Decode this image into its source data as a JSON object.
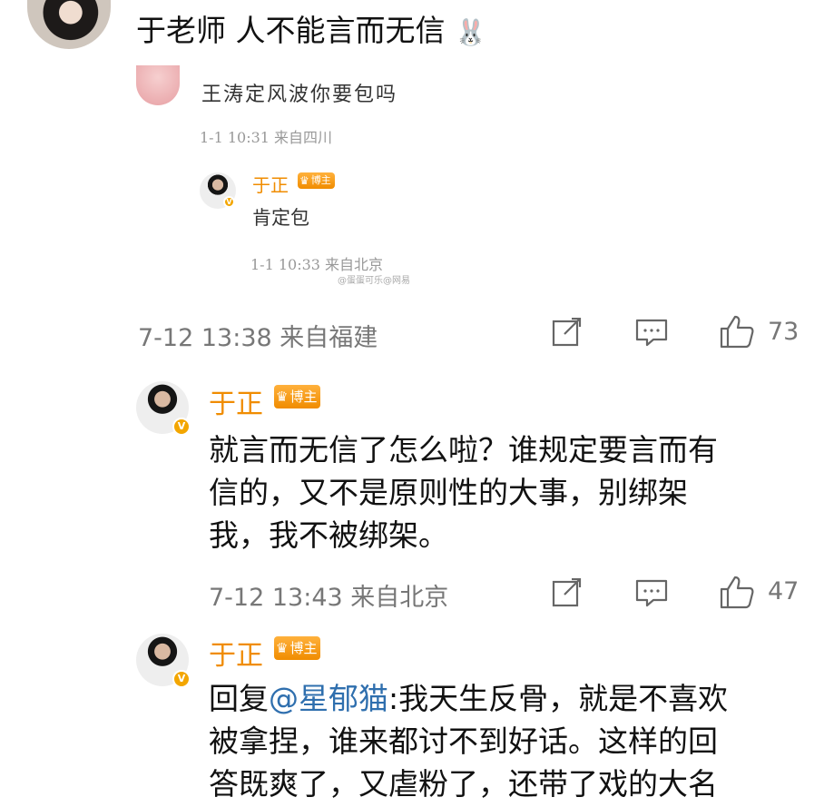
{
  "top_comment": {
    "text": "于老师 人不能言而无信",
    "emoji": "🐰"
  },
  "screenshot_quote": {
    "comment_text": "王涛定风波你要包吗",
    "comment_meta": "1-1 10:31 来自四川",
    "reply_author": "于正",
    "reply_badge": "博主",
    "reply_text": "肯定包",
    "reply_meta": "1-1 10:33 来自北京",
    "watermark": "@蛋蛋可乐@网易"
  },
  "top_comment_footer": {
    "meta": "7-12 13:38 来自福建",
    "likes": "73"
  },
  "reply1": {
    "author": "于正",
    "badge": "博主",
    "line1": "就言而无信了怎么啦？谁规定要言而有",
    "line2": "信的，又不是原则性的大事，别绑架",
    "line3": "我，我不被绑架。",
    "meta": "7-12 13:43 来自北京",
    "likes": "47"
  },
  "reply2": {
    "author": "于正",
    "badge": "博主",
    "prefix": "回复",
    "mention": "@星郁猫",
    "line1_rest": ":我天生反骨，就是不喜欢",
    "line2": "被拿捏，谁来都讨不到好话。这样的回",
    "line3": "答既爽了，又虐粉了，还带了戏的大名"
  },
  "icons": {
    "share": "share-icon",
    "comment": "comment-icon",
    "like": "thumbs-up-icon",
    "verified": "verified-v-icon",
    "crown": "crown-icon"
  },
  "colors": {
    "author_orange": "#f08c00",
    "mention_blue": "#2f6fae",
    "meta_gray": "#777777"
  }
}
